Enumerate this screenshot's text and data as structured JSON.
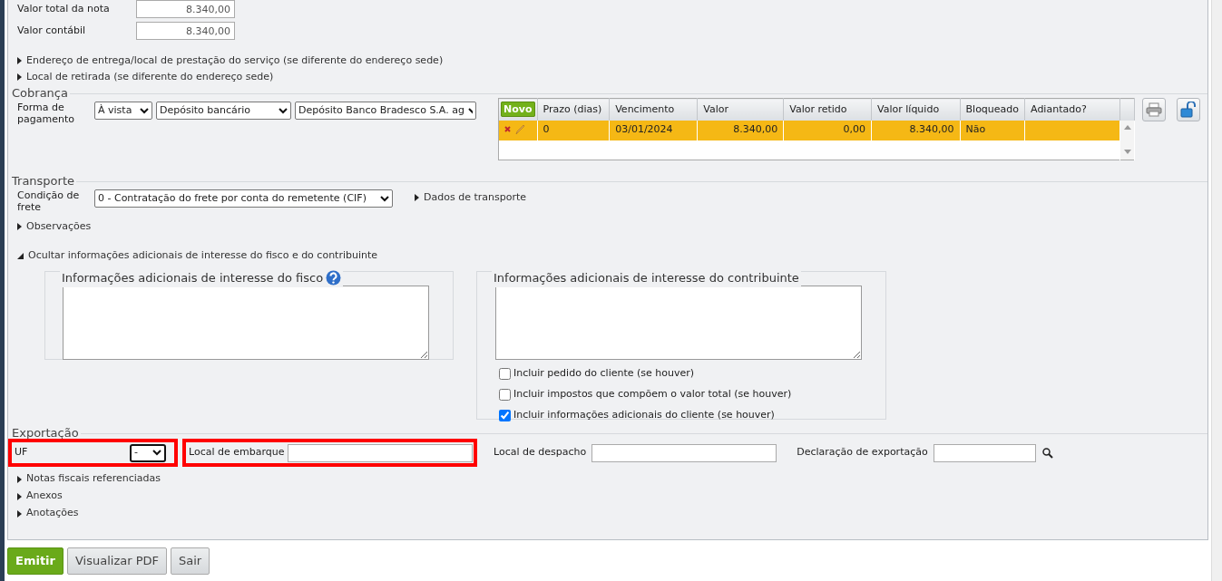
{
  "summary_fields": [
    {
      "label": "Valor total da nota",
      "value": "8.340,00"
    },
    {
      "label": "Valor contábil",
      "value": "8.340,00"
    }
  ],
  "top_expanders": [
    {
      "label": "Endereço de entrega/local de prestação do serviço (se diferente do endereço sede)",
      "expanded": false
    },
    {
      "label": "Local de retirada (se diferente do endereço sede)",
      "expanded": false
    }
  ],
  "cobranca": {
    "title": "Cobrança",
    "label": "Forma de pagamento",
    "selects": [
      "À vista",
      "Depósito bancário",
      "Depósito Banco Bradesco S.A. ag"
    ],
    "grid": {
      "new_button": "Novo",
      "columns": [
        "Prazo (dias)",
        "Vencimento",
        "Valor",
        "Valor retido",
        "Valor líquido",
        "Bloqueado",
        "Adiantado?"
      ],
      "rows": [
        {
          "selected": true,
          "cells": [
            "0",
            "03/01/2024",
            "8.340,00",
            "0,00",
            "8.340,00",
            "Não",
            ""
          ]
        }
      ]
    }
  },
  "transporte": {
    "title": "Transporte",
    "label": "Condição de frete",
    "select": "0 - Contratação do frete por conta do remetente (CIF)",
    "link": {
      "label": "Dados de transporte",
      "expanded": false
    }
  },
  "middle_expanders": [
    {
      "label": "Observações",
      "expanded": false
    },
    {
      "label": "Ocultar informações adicionais de interesse do fisco e do contribuinte",
      "expanded": true
    }
  ],
  "info_fisco": {
    "title": "Informações adicionais de interesse do fisco"
  },
  "info_contribuinte": {
    "title": "Informações adicionais de interesse do contribuinte",
    "options": [
      {
        "label": "Incluir pedido do cliente (se houver)",
        "checked": false
      },
      {
        "label": "Incluir impostos que compõem o valor total (se houver)",
        "checked": false
      },
      {
        "label": "Incluir informações adicionais do cliente (se houver)",
        "checked": true
      }
    ]
  },
  "exportacao": {
    "title": "Exportação",
    "fields": [
      {
        "label": "UF",
        "kind": "select",
        "value": "-",
        "highlighted": true
      },
      {
        "label": "Local de embarque",
        "kind": "input",
        "highlighted": true
      },
      {
        "label": "Local de despacho",
        "kind": "input",
        "highlighted": false
      },
      {
        "label": "Declaração de exportação",
        "kind": "lookup",
        "highlighted": false
      }
    ]
  },
  "bottom_expanders": [
    {
      "label": "Notas fiscais referenciadas",
      "expanded": false
    },
    {
      "label": "Anexos",
      "expanded": false
    },
    {
      "label": "Anotações",
      "expanded": false
    }
  ],
  "buttons": [
    {
      "label": "Emitir",
      "kind": "primary"
    },
    {
      "label": "Visualizar PDF",
      "kind": "secondary"
    },
    {
      "label": "Sair",
      "kind": "secondary"
    }
  ]
}
